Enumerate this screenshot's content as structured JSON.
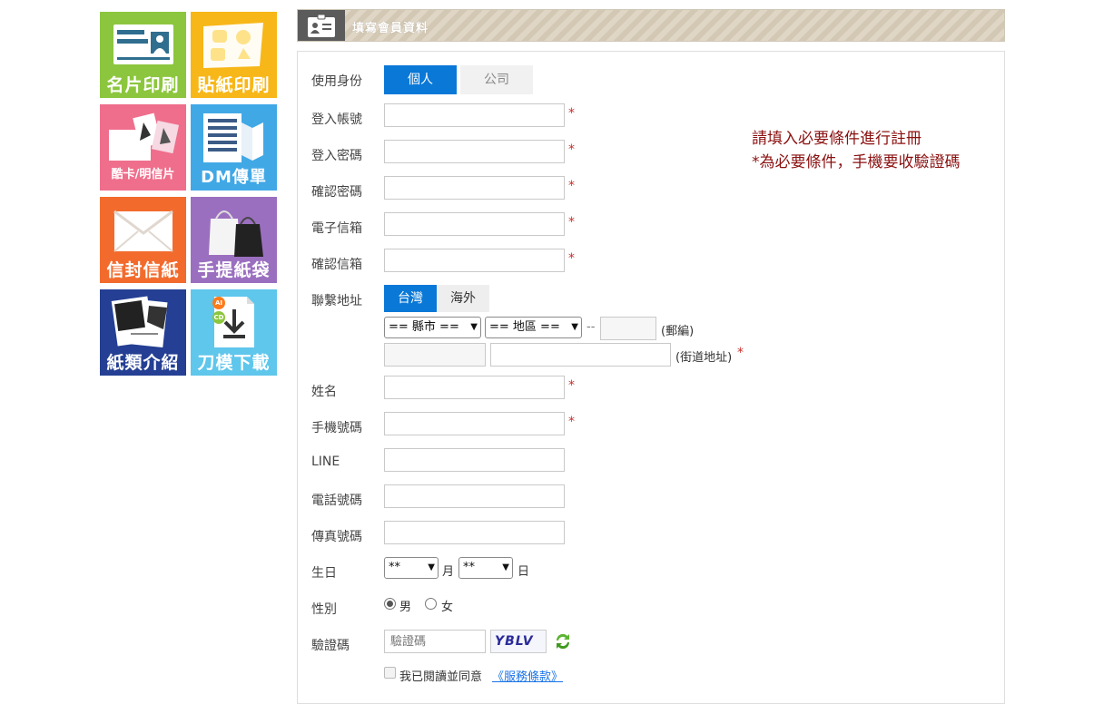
{
  "sidebar": {
    "tiles": [
      {
        "label": "名片印刷",
        "color": "#8cc63e"
      },
      {
        "label": "貼紙印刷",
        "color": "#f7b718"
      },
      {
        "label": "酷卡/明信片",
        "color": "#ef6e8c"
      },
      {
        "label": "DM傳單",
        "color": "#41a8e6"
      },
      {
        "label": "信封信紙",
        "color": "#f26b2d"
      },
      {
        "label": "手提紙袋",
        "color": "#9b6fbf"
      },
      {
        "label": "紙類介紹",
        "color": "#243f93"
      },
      {
        "label": "刀模下載",
        "color": "#5fc6ec"
      }
    ],
    "download_badges": [
      "AI",
      "CD"
    ]
  },
  "header": {
    "title": "填寫會員資料"
  },
  "form": {
    "identity": {
      "label": "使用身份",
      "options": [
        "個人",
        "公司"
      ],
      "selected": "個人"
    },
    "account": {
      "label": "登入帳號",
      "value": ""
    },
    "password": {
      "label": "登入密碼",
      "value": ""
    },
    "confirm_password": {
      "label": "確認密碼",
      "value": ""
    },
    "email": {
      "label": "電子信箱",
      "value": ""
    },
    "confirm_email": {
      "label": "確認信箱",
      "value": ""
    },
    "address": {
      "label": "聯繫地址",
      "tabs": [
        "台灣",
        "海外"
      ],
      "selected_tab": "台灣",
      "county_select": "== 縣市 ==",
      "district_select": "== 地區 ==",
      "dash": "--",
      "zip_value": "",
      "zip_note": "(郵編)",
      "street_note": "(街道地址)"
    },
    "name": {
      "label": "姓名",
      "value": ""
    },
    "mobile": {
      "label": "手機號碼",
      "value": ""
    },
    "line": {
      "label": "LINE",
      "value": ""
    },
    "phone": {
      "label": "電話號碼",
      "value": ""
    },
    "fax": {
      "label": "傳真號碼",
      "value": ""
    },
    "birthday": {
      "label": "生日",
      "month_select": "**",
      "month_unit": "月",
      "day_select": "**",
      "day_unit": "日"
    },
    "gender": {
      "label": "性別",
      "options": [
        "男",
        "女"
      ],
      "selected": "男"
    },
    "captcha": {
      "label": "驗證碼",
      "placeholder": "驗證碼",
      "image_text": "YBLV"
    },
    "terms": {
      "text": "我已閱讀並同意",
      "link": "《服務條款》",
      "checked": false
    },
    "required_mark": "*"
  },
  "notice": {
    "line1": "請填入必要條件進行註冊",
    "line2": "*為必要條件，手機要收驗證碼"
  },
  "colors": {
    "accent": "#0a78d7",
    "required": "#c9302c",
    "notice": "#8b1010"
  }
}
